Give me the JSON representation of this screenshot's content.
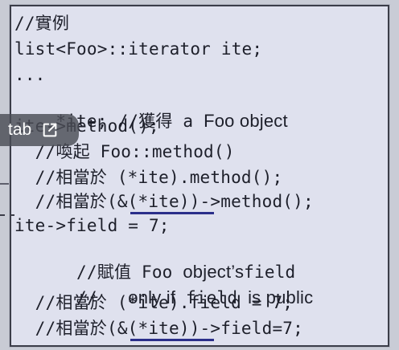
{
  "code_lines": [
    "//實例",
    "list<Foo>::iterator ite;",
    "...",
    "*ite; //獲得 a ",
    "ite->method();",
    "  //喚起 Foo::method()",
    "  //相當於 (*ite).method();",
    "  //相當於(&(*ite))->method();",
    "ite->field = 7;",
    "  //賦值 Foo ",
    "  //   ",
    "  //相當於 (*ite).field = 7;",
    "  //相當於(&(*ite))->field=7;"
  ],
  "sans_fragments": {
    "foo_object": "Foo object",
    "foo_objects": "object’s",
    "field_word": "field",
    "only_if": "only if",
    "field_word2": "field",
    "is_public": "is public"
  },
  "tab_chip": {
    "label": "tab",
    "icon": "open-external-icon"
  },
  "colors": {
    "panel_bg": "#dfe1ee",
    "text": "#1d1f2a",
    "underline": "#2b2f8a",
    "chip_bg": "#4a4d56"
  }
}
